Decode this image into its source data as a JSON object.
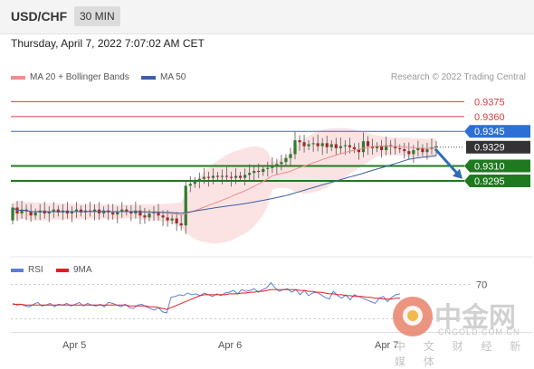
{
  "header": {
    "symbol": "USD/CHF",
    "timeframe": "30 MIN"
  },
  "timestamp": "Thursday, April 7, 2022 7:07:02 AM CET",
  "legend": {
    "ma20": {
      "label": "MA 20 + Bollinger Bands",
      "color": "#f08c8c"
    },
    "ma50": {
      "label": "MA 50",
      "color": "#3a5fa0"
    },
    "credit": "Research © 2022 Trading Central"
  },
  "rsi_legend": {
    "rsi": {
      "label": "RSI",
      "color": "#5b7fd6"
    },
    "ma9": {
      "label": "9MA",
      "color": "#e02020"
    }
  },
  "watermark": {
    "brand": "中金网",
    "url": "CNGOLD.COM.CN",
    "tagline": "中 文 财 经 新 媒 体"
  },
  "chart_data": [
    {
      "type": "candlestick",
      "x_ticks": [
        "Apr 5",
        "Apr 6",
        "Apr 7"
      ],
      "ylim": [
        0.922,
        0.939
      ],
      "price_levels": [
        {
          "value": 0.9375,
          "label": "0.9375",
          "kind": "resistance",
          "color": "#d04040"
        },
        {
          "value": 0.936,
          "label": "0.9360",
          "kind": "resistance",
          "color": "#d04040"
        },
        {
          "value": 0.9345,
          "label": "0.9345",
          "kind": "pivot",
          "color": "#2e6fd6"
        },
        {
          "value": 0.9329,
          "label": "0.9329",
          "kind": "last",
          "color": "#333333"
        },
        {
          "value": 0.931,
          "label": "0.9310",
          "kind": "support",
          "color": "#1f7a1f"
        },
        {
          "value": 0.9295,
          "label": "0.9295",
          "kind": "support",
          "color": "#1f7a1f"
        }
      ],
      "close": [
        0.9268,
        0.9262,
        0.9266,
        0.9264,
        0.926,
        0.9263,
        0.9265,
        0.9262,
        0.9264,
        0.9266,
        0.9263,
        0.9265,
        0.9262,
        0.9264,
        0.9266,
        0.9263,
        0.9265,
        0.9264,
        0.9266,
        0.9262,
        0.9265,
        0.9263,
        0.9261,
        0.9264,
        0.9266,
        0.9264,
        0.9262,
        0.9265,
        0.926,
        0.9258,
        0.9262,
        0.9263,
        0.926,
        0.9258,
        0.9255,
        0.9257,
        0.9252,
        0.925,
        0.929,
        0.9292,
        0.9295,
        0.9297,
        0.9299,
        0.9298,
        0.93,
        0.9299,
        0.93,
        0.9299,
        0.9298,
        0.93,
        0.9298,
        0.9301,
        0.9303,
        0.9305,
        0.9304,
        0.9307,
        0.9308,
        0.931,
        0.9312,
        0.9314,
        0.9318,
        0.9322,
        0.9336,
        0.9334,
        0.933,
        0.9332,
        0.9333,
        0.933,
        0.9333,
        0.9329,
        0.9332,
        0.9328,
        0.933,
        0.9331,
        0.9329,
        0.9327,
        0.9324,
        0.9335,
        0.933,
        0.9328,
        0.933,
        0.9326,
        0.9331,
        0.933,
        0.9328,
        0.9327,
        0.9325,
        0.9322,
        0.9326,
        0.9328,
        0.9324,
        0.9327,
        0.9329,
        0.933
      ],
      "open": [
        0.9255,
        0.9268,
        0.9262,
        0.9266,
        0.9264,
        0.926,
        0.9263,
        0.9265,
        0.9262,
        0.9264,
        0.9266,
        0.9263,
        0.9265,
        0.9262,
        0.9264,
        0.9266,
        0.9263,
        0.9265,
        0.9264,
        0.9266,
        0.9262,
        0.9265,
        0.9263,
        0.9261,
        0.9264,
        0.9266,
        0.9264,
        0.9262,
        0.9265,
        0.926,
        0.9258,
        0.9262,
        0.9263,
        0.926,
        0.9258,
        0.9255,
        0.9257,
        0.9252,
        0.925,
        0.929,
        0.9292,
        0.9295,
        0.9297,
        0.9299,
        0.9298,
        0.93,
        0.9299,
        0.93,
        0.9299,
        0.9298,
        0.93,
        0.9298,
        0.9301,
        0.9303,
        0.9305,
        0.9304,
        0.9307,
        0.9308,
        0.931,
        0.9312,
        0.9314,
        0.9318,
        0.9322,
        0.9336,
        0.9334,
        0.933,
        0.9332,
        0.9333,
        0.933,
        0.9333,
        0.9329,
        0.9332,
        0.9328,
        0.933,
        0.9331,
        0.9329,
        0.9327,
        0.9324,
        0.9335,
        0.933,
        0.9328,
        0.933,
        0.9326,
        0.9331,
        0.933,
        0.9328,
        0.9327,
        0.9325,
        0.9322,
        0.9326,
        0.9328,
        0.9324,
        0.9327,
        0.9329
      ],
      "forecast": {
        "from": 0.9327,
        "to": 0.9297
      }
    },
    {
      "type": "line",
      "title": "RSI",
      "ylim": [
        20,
        80
      ],
      "levels": [
        70,
        30
      ],
      "tick_labels": [
        "70"
      ],
      "rsi": [
        48,
        46,
        47,
        45,
        44,
        47,
        49,
        45,
        46,
        48,
        44,
        47,
        46,
        48,
        45,
        47,
        49,
        45,
        48,
        46,
        45,
        47,
        44,
        49,
        48,
        46,
        44,
        47,
        43,
        42,
        46,
        47,
        44,
        42,
        40,
        43,
        38,
        37,
        55,
        56,
        58,
        57,
        60,
        58,
        59,
        57,
        60,
        58,
        56,
        59,
        57,
        60,
        61,
        63,
        59,
        64,
        62,
        63,
        65,
        61,
        64,
        66,
        72,
        66,
        62,
        64,
        65,
        61,
        64,
        58,
        63,
        57,
        60,
        61,
        58,
        55,
        53,
        62,
        57,
        54,
        58,
        52,
        58,
        56,
        54,
        52,
        50,
        48,
        54,
        56,
        50,
        55,
        58,
        59
      ],
      "ma9": [
        47,
        47,
        47,
        46,
        46,
        46,
        46,
        46,
        46,
        46,
        46,
        46,
        46,
        46,
        46,
        46,
        46,
        46,
        46,
        46,
        46,
        46,
        46,
        46,
        46,
        46,
        46,
        46,
        45,
        45,
        45,
        45,
        45,
        44,
        44,
        43,
        42,
        41,
        43,
        45,
        47,
        49,
        51,
        53,
        55,
        57,
        58,
        58,
        58,
        58,
        58,
        58,
        59,
        59,
        59,
        60,
        60,
        61,
        61,
        62,
        62,
        63,
        64,
        64,
        64,
        64,
        64,
        64,
        64,
        63,
        63,
        62,
        62,
        61,
        61,
        60,
        59,
        59,
        58,
        58,
        57,
        57,
        56,
        56,
        56,
        55,
        55,
        54,
        54,
        53,
        53,
        53,
        54,
        54
      ]
    }
  ]
}
